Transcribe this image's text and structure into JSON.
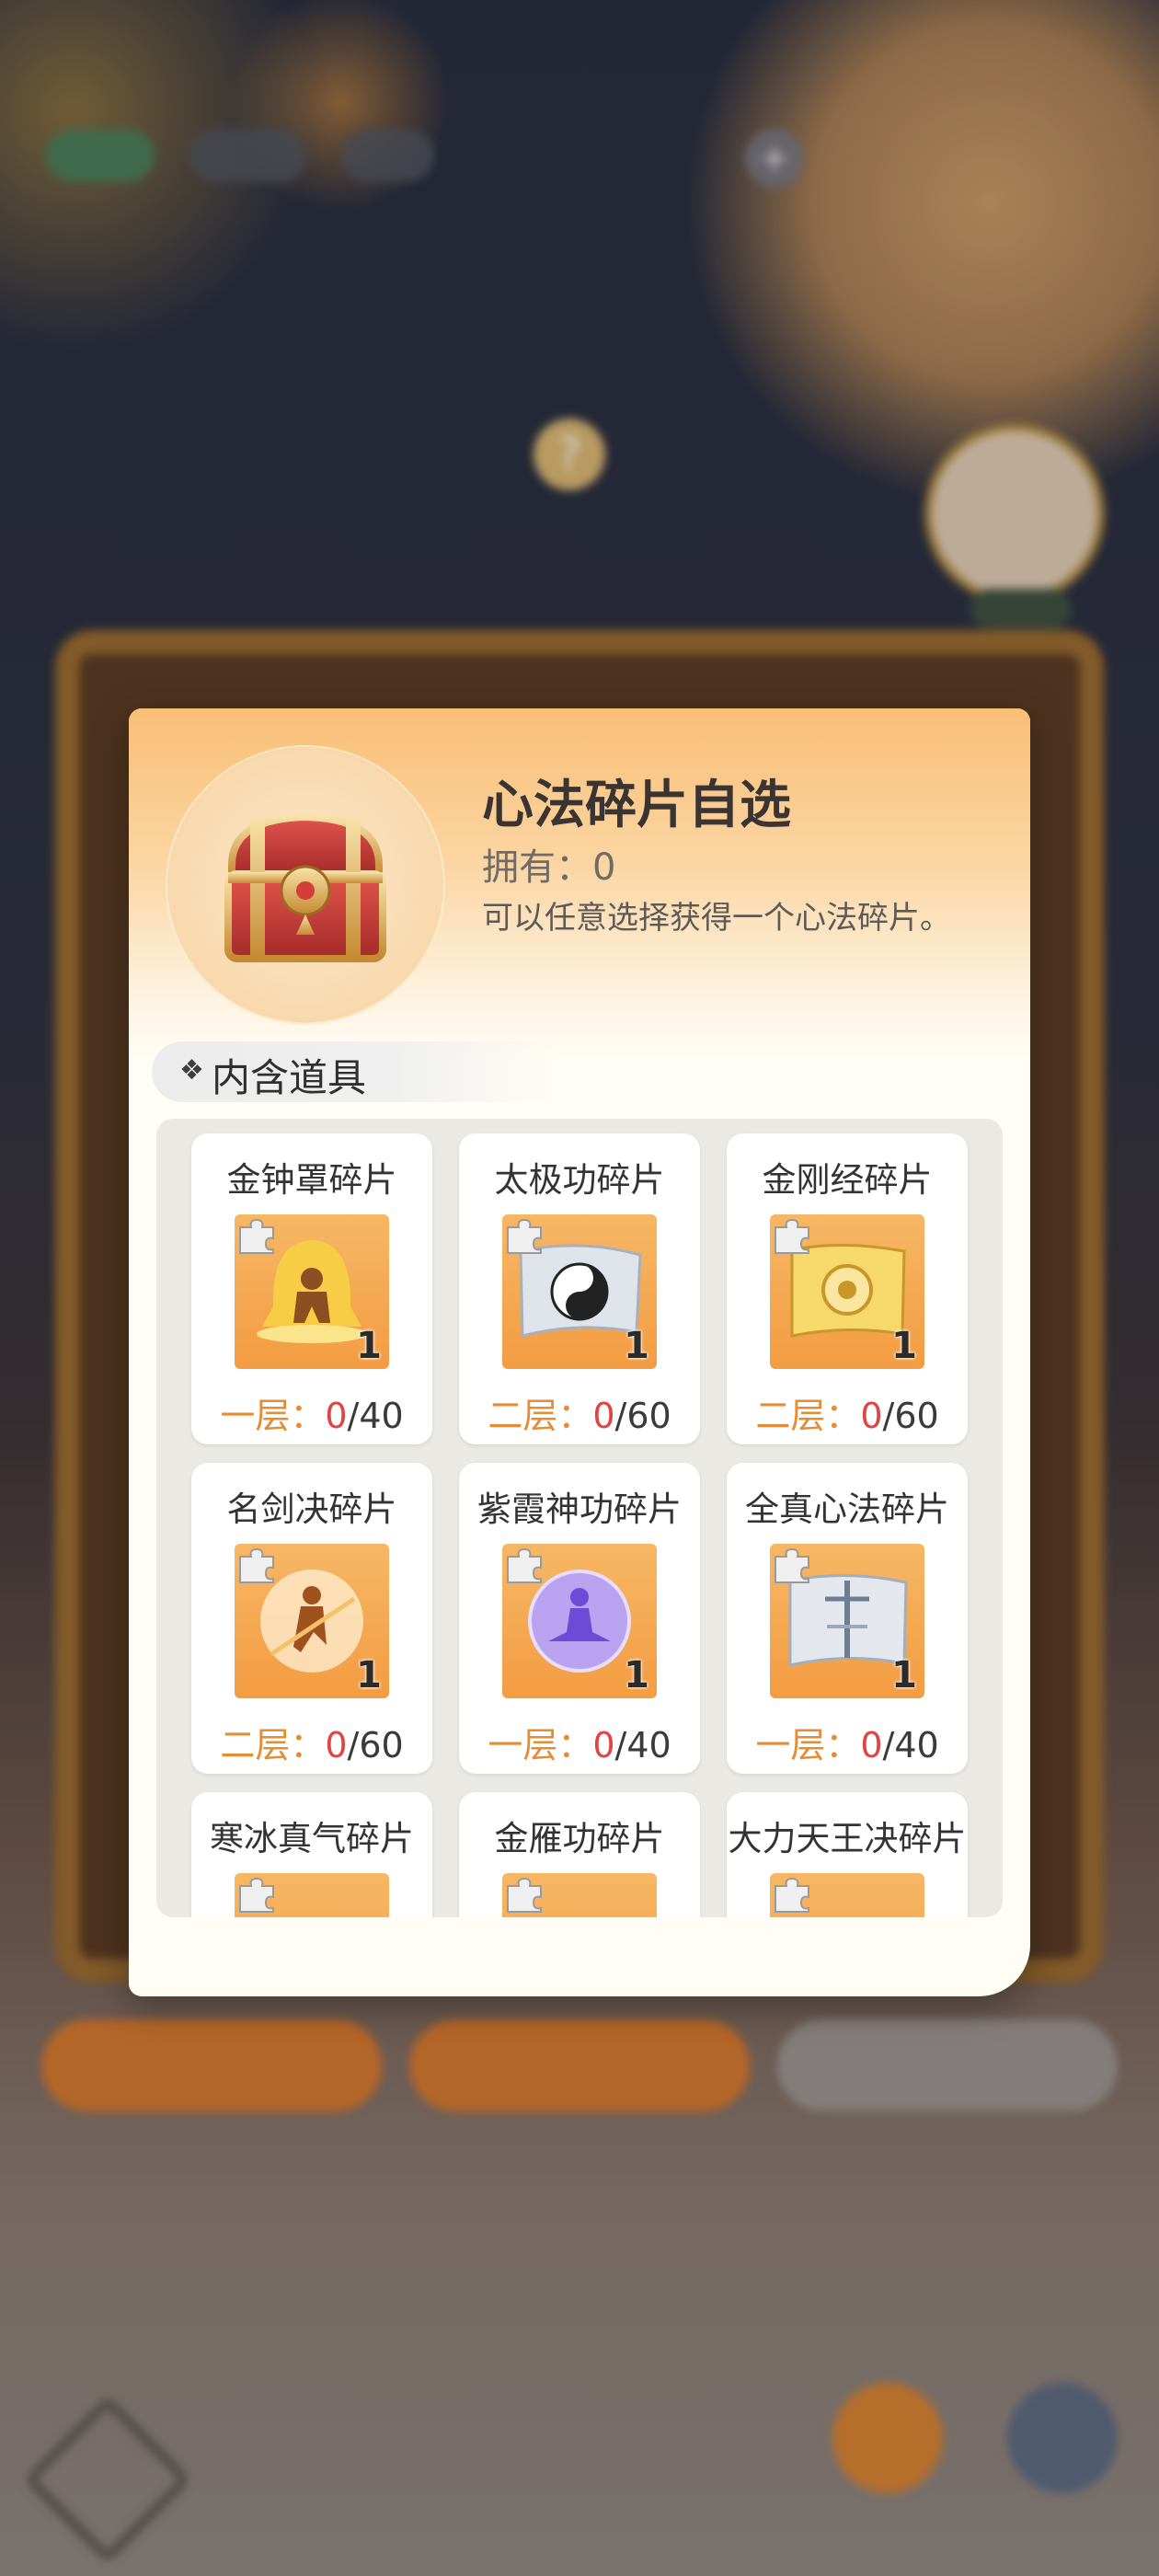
{
  "modal": {
    "title": "心法碎片自选",
    "owned": "拥有：0",
    "description": "可以任意选择获得一个心法碎片。",
    "section_label": "内含道具",
    "items": [
      {
        "name": "金钟罩碎片",
        "count": "1",
        "tier": "一层：",
        "current": "0",
        "total": "/40",
        "icon": "golden-bell-figure-icon"
      },
      {
        "name": "太极功碎片",
        "count": "1",
        "tier": "二层：",
        "current": "0",
        "total": "/60",
        "icon": "yin-yang-scroll-icon"
      },
      {
        "name": "金刚经碎片",
        "count": "1",
        "tier": "二层：",
        "current": "0",
        "total": "/60",
        "icon": "golden-scroll-icon"
      },
      {
        "name": "名剑决碎片",
        "count": "1",
        "tier": "二层：",
        "current": "0",
        "total": "/60",
        "icon": "swordsman-figure-icon"
      },
      {
        "name": "紫霞神功碎片",
        "count": "1",
        "tier": "一层：",
        "current": "0",
        "total": "/40",
        "icon": "purple-meditation-icon"
      },
      {
        "name": "全真心法碎片",
        "count": "1",
        "tier": "一层：",
        "current": "0",
        "total": "/40",
        "icon": "silver-scroll-icon"
      },
      {
        "name": "寒冰真气碎片",
        "icon": "puzzle-piece-icon"
      },
      {
        "name": "金雁功碎片",
        "icon": "puzzle-piece-icon"
      },
      {
        "name": "大力天王决碎片",
        "icon": "puzzle-piece-icon"
      }
    ]
  },
  "colors": {
    "accent_orange": "#e58d35",
    "progress_red": "#e04444",
    "icon_bg": "#f39c42"
  }
}
